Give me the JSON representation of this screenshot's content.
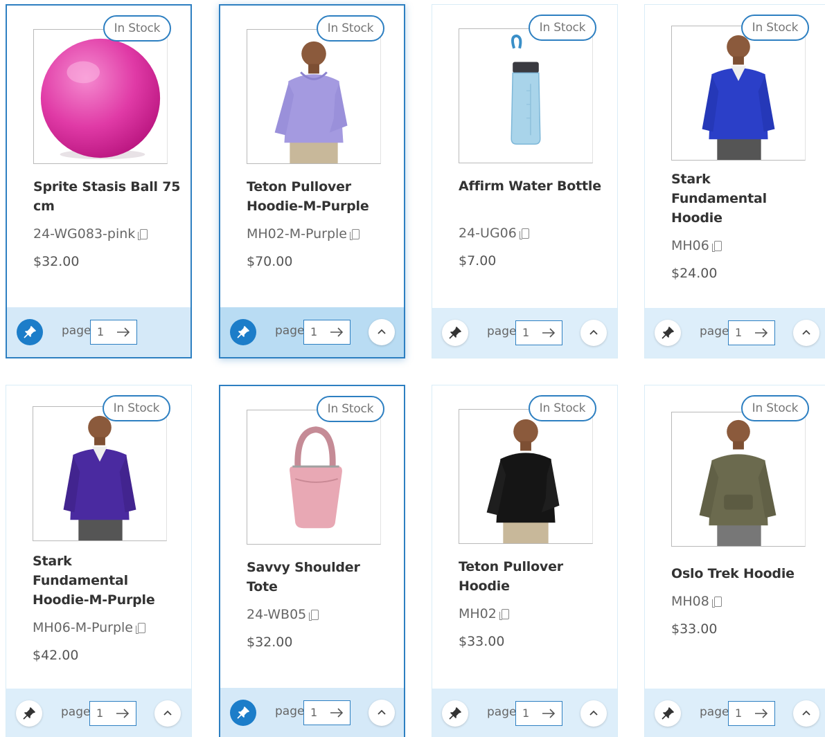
{
  "badge_label": "In Stock",
  "page_label": "page",
  "colors": {
    "accent": "#2d7fc1",
    "footer": "#ddeefa",
    "pin_active": "#1c7dc9"
  },
  "products": [
    {
      "name": "Sprite Stasis Ball 75 cm",
      "sku": "24-WG083-pink",
      "price": "$32.00",
      "page": "1"
    },
    {
      "name": "Teton Pullover Hoodie-M-Purple",
      "sku": "MH02-M-Purple",
      "price": "$70.00",
      "page": "1"
    },
    {
      "name": "Affirm Water Bottle",
      "sku": "24-UG06",
      "price": "$7.00",
      "page": "1"
    },
    {
      "name": "Stark Fundamental Hoodie",
      "sku": "MH06",
      "price": "$24.00",
      "page": "1"
    },
    {
      "name": "Stark Fundamental Hoodie-M-Purple",
      "sku": "MH06-M-Purple",
      "price": "$42.00",
      "page": "1"
    },
    {
      "name": "Savvy Shoulder Tote",
      "sku": "24-WB05",
      "price": "$32.00",
      "page": "1"
    },
    {
      "name": "Teton Pullover Hoodie",
      "sku": "MH02",
      "price": "$33.00",
      "page": "1"
    },
    {
      "name": "Oslo Trek Hoodie",
      "sku": "MH08",
      "price": "$33.00",
      "page": "1"
    }
  ]
}
